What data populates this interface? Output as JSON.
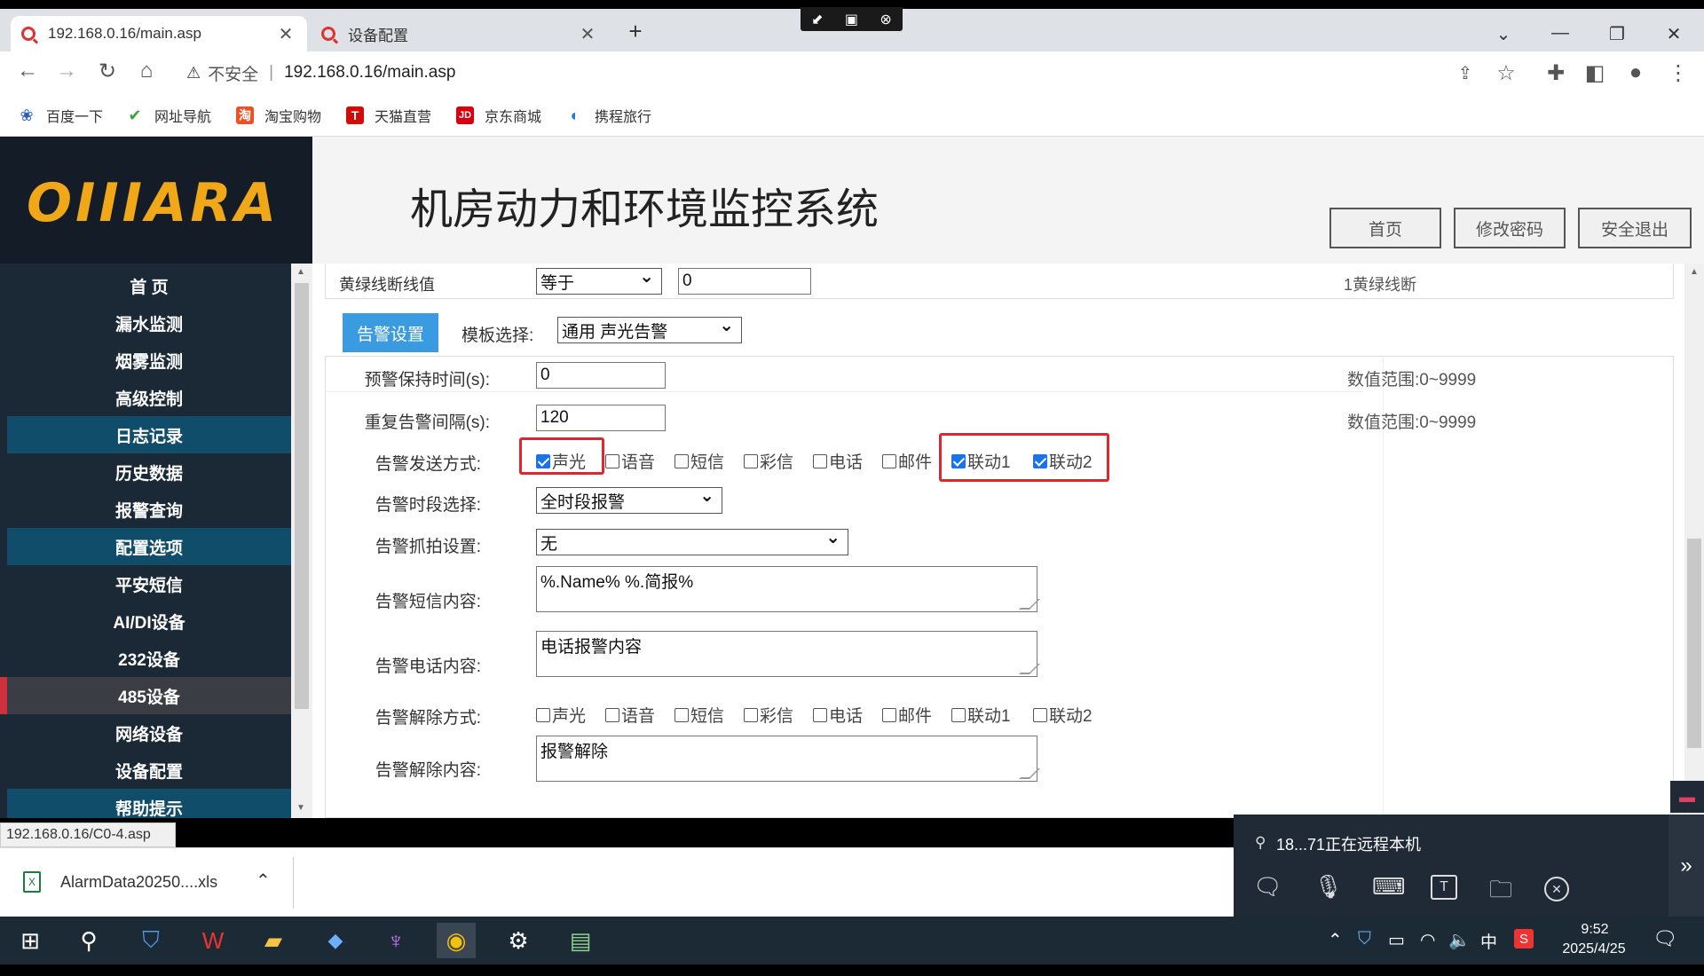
{
  "browser": {
    "tabs": [
      {
        "title": "192.168.0.16/main.asp"
      },
      {
        "title": "设备配置"
      }
    ],
    "address": {
      "security": "不安全",
      "url": "192.168.0.16/main.asp"
    },
    "bookmarks": [
      {
        "label": "百度一下"
      },
      {
        "label": "网址导航"
      },
      {
        "label": "淘宝购物"
      },
      {
        "label": "天猫直营"
      },
      {
        "label": "京东商城"
      },
      {
        "label": "携程旅行"
      }
    ],
    "status_url": "192.168.0.16/C0-4.asp"
  },
  "header": {
    "logo": "OIIIARA",
    "title": "机房动力和环境监控系统",
    "buttons": {
      "home": "首页",
      "change_password": "修改密码",
      "logout": "安全退出"
    }
  },
  "sidebar": {
    "items": [
      {
        "label": "首 页"
      },
      {
        "label": "漏水监测"
      },
      {
        "label": "烟雾监测"
      },
      {
        "label": "高级控制"
      },
      {
        "label": "日志记录"
      },
      {
        "label": "历史数据"
      },
      {
        "label": "报警查询"
      },
      {
        "label": "配置选项"
      },
      {
        "label": "平安短信"
      },
      {
        "label": "AI/DI设备"
      },
      {
        "label": "232设备"
      },
      {
        "label": "485设备"
      },
      {
        "label": "网络设备"
      },
      {
        "label": "设备配置"
      },
      {
        "label": "帮助提示"
      }
    ]
  },
  "form": {
    "yellow_green": {
      "label": "黄绿线断线值",
      "operator": "等于",
      "value": "0",
      "hint": "1黄绿线断"
    },
    "alarm_tab": "告警设置",
    "template": {
      "label": "模板选择:",
      "value": "通用 声光告警"
    },
    "pre_alarm_hold": {
      "label": "预警保持时间(s):",
      "value": "0",
      "hint": "数值范围:0~9999"
    },
    "repeat_interval": {
      "label": "重复告警间隔(s):",
      "value": "120",
      "hint": "数值范围:0~9999"
    },
    "send_method": {
      "label": "告警发送方式:",
      "options": [
        {
          "label": "声光",
          "checked": true
        },
        {
          "label": "语音",
          "checked": false
        },
        {
          "label": "短信",
          "checked": false
        },
        {
          "label": "彩信",
          "checked": false
        },
        {
          "label": "电话",
          "checked": false
        },
        {
          "label": "邮件",
          "checked": false
        },
        {
          "label": "联动1",
          "checked": true
        },
        {
          "label": "联动2",
          "checked": true
        }
      ]
    },
    "time_period": {
      "label": "告警时段选择:",
      "value": "全时段报警"
    },
    "snapshot": {
      "label": "告警抓拍设置:",
      "value": "无"
    },
    "sms_content": {
      "label": "告警短信内容:",
      "value": "%.Name% %.简报%"
    },
    "phone_content": {
      "label": "告警电话内容:",
      "value": "电话报警内容"
    },
    "release_method": {
      "label": "告警解除方式:",
      "options": [
        {
          "label": "声光",
          "checked": false
        },
        {
          "label": "语音",
          "checked": false
        },
        {
          "label": "短信",
          "checked": false
        },
        {
          "label": "彩信",
          "checked": false
        },
        {
          "label": "电话",
          "checked": false
        },
        {
          "label": "邮件",
          "checked": false
        },
        {
          "label": "联动1",
          "checked": false
        },
        {
          "label": "联动2",
          "checked": false
        }
      ]
    },
    "release_content": {
      "label": "告警解除内容:",
      "value": "报警解除"
    }
  },
  "download": {
    "filename": "AlarmData20250....xls"
  },
  "remote": {
    "text": "18...71正在远程本机"
  },
  "taskbar": {
    "time": "9:52",
    "date": "2025/4/25",
    "ime": "中"
  },
  "colors": {
    "accent": "#3a9be0",
    "sidebar": "#1b2836",
    "highlight": "#e0262d",
    "logo": "#f0a818"
  }
}
